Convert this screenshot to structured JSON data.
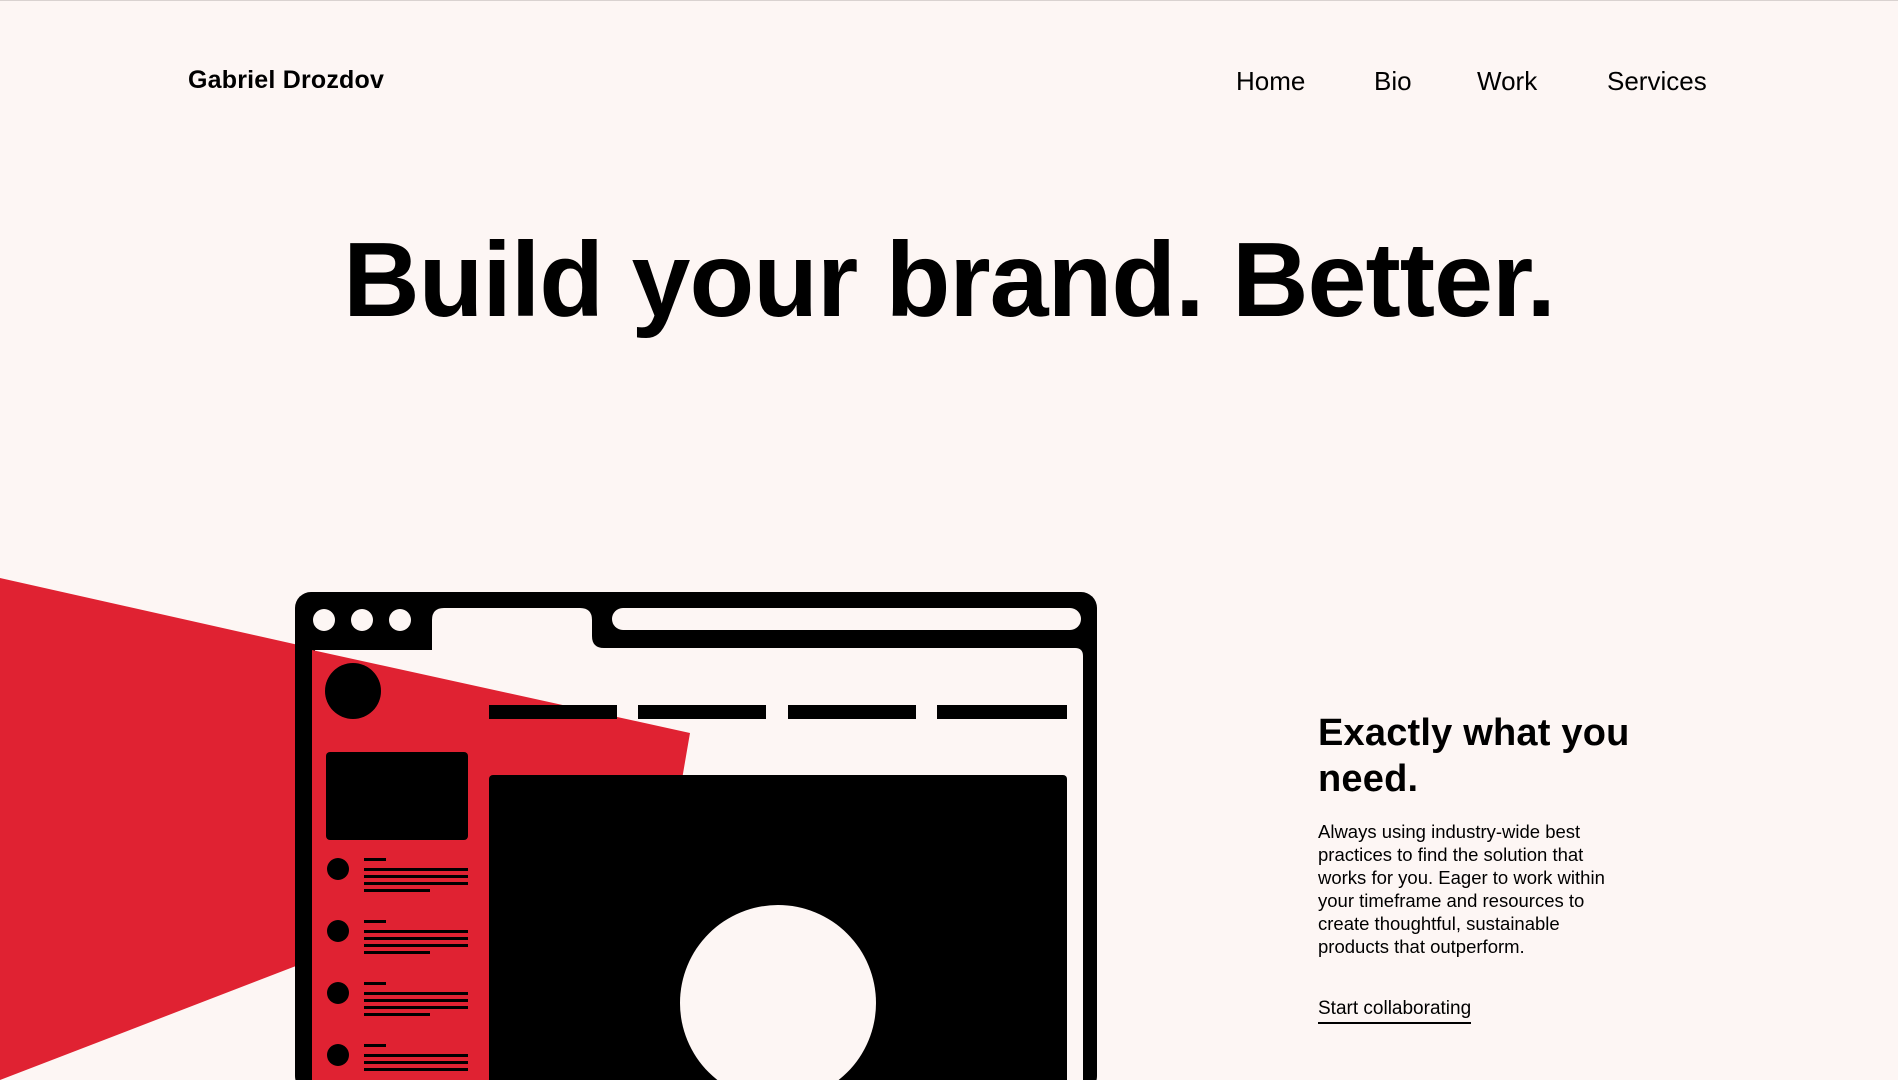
{
  "header": {
    "brand": "Gabriel Drozdov",
    "nav": [
      {
        "label": "Home"
      },
      {
        "label": "Bio"
      },
      {
        "label": "Work"
      },
      {
        "label": "Services"
      }
    ]
  },
  "hero": {
    "title": "Build your brand. Better."
  },
  "feature": {
    "title": "Exactly what you need.",
    "body": "Always using industry-wide best practices to find the solution that works for you. Eager to work within your timeframe and resources to create thoughtful, sustainable products that outperform.",
    "cta": "Start collaborating"
  },
  "colors": {
    "background": "#fdf6f4",
    "accent": "#e02232",
    "ink": "#000000"
  }
}
